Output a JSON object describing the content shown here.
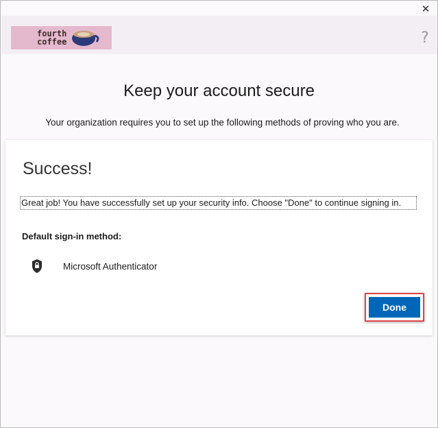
{
  "window": {
    "close_glyph": "✕",
    "help_glyph": "?"
  },
  "brand": {
    "logo_line1": "fourth",
    "logo_line2": "coffee",
    "logo_bg": "#e5b9cd",
    "icon": "coffee-cup-icon"
  },
  "header": {
    "title": "Keep your account secure",
    "subtitle": "Your organization requires you to set up the following methods of proving who you are."
  },
  "card": {
    "heading": "Success!",
    "message": "Great job! You have successfully set up your security info. Choose \"Done\" to continue signing in.",
    "default_method_label": "Default sign-in method:",
    "method": {
      "icon": "authenticator-lock-icon",
      "label": "Microsoft Authenticator"
    },
    "done_label": "Done"
  },
  "colors": {
    "primary_button": "#0067b8",
    "highlight_border": "#e0474c",
    "banner_bg": "#f3eef3",
    "page_bg": "#fcf9fc"
  }
}
